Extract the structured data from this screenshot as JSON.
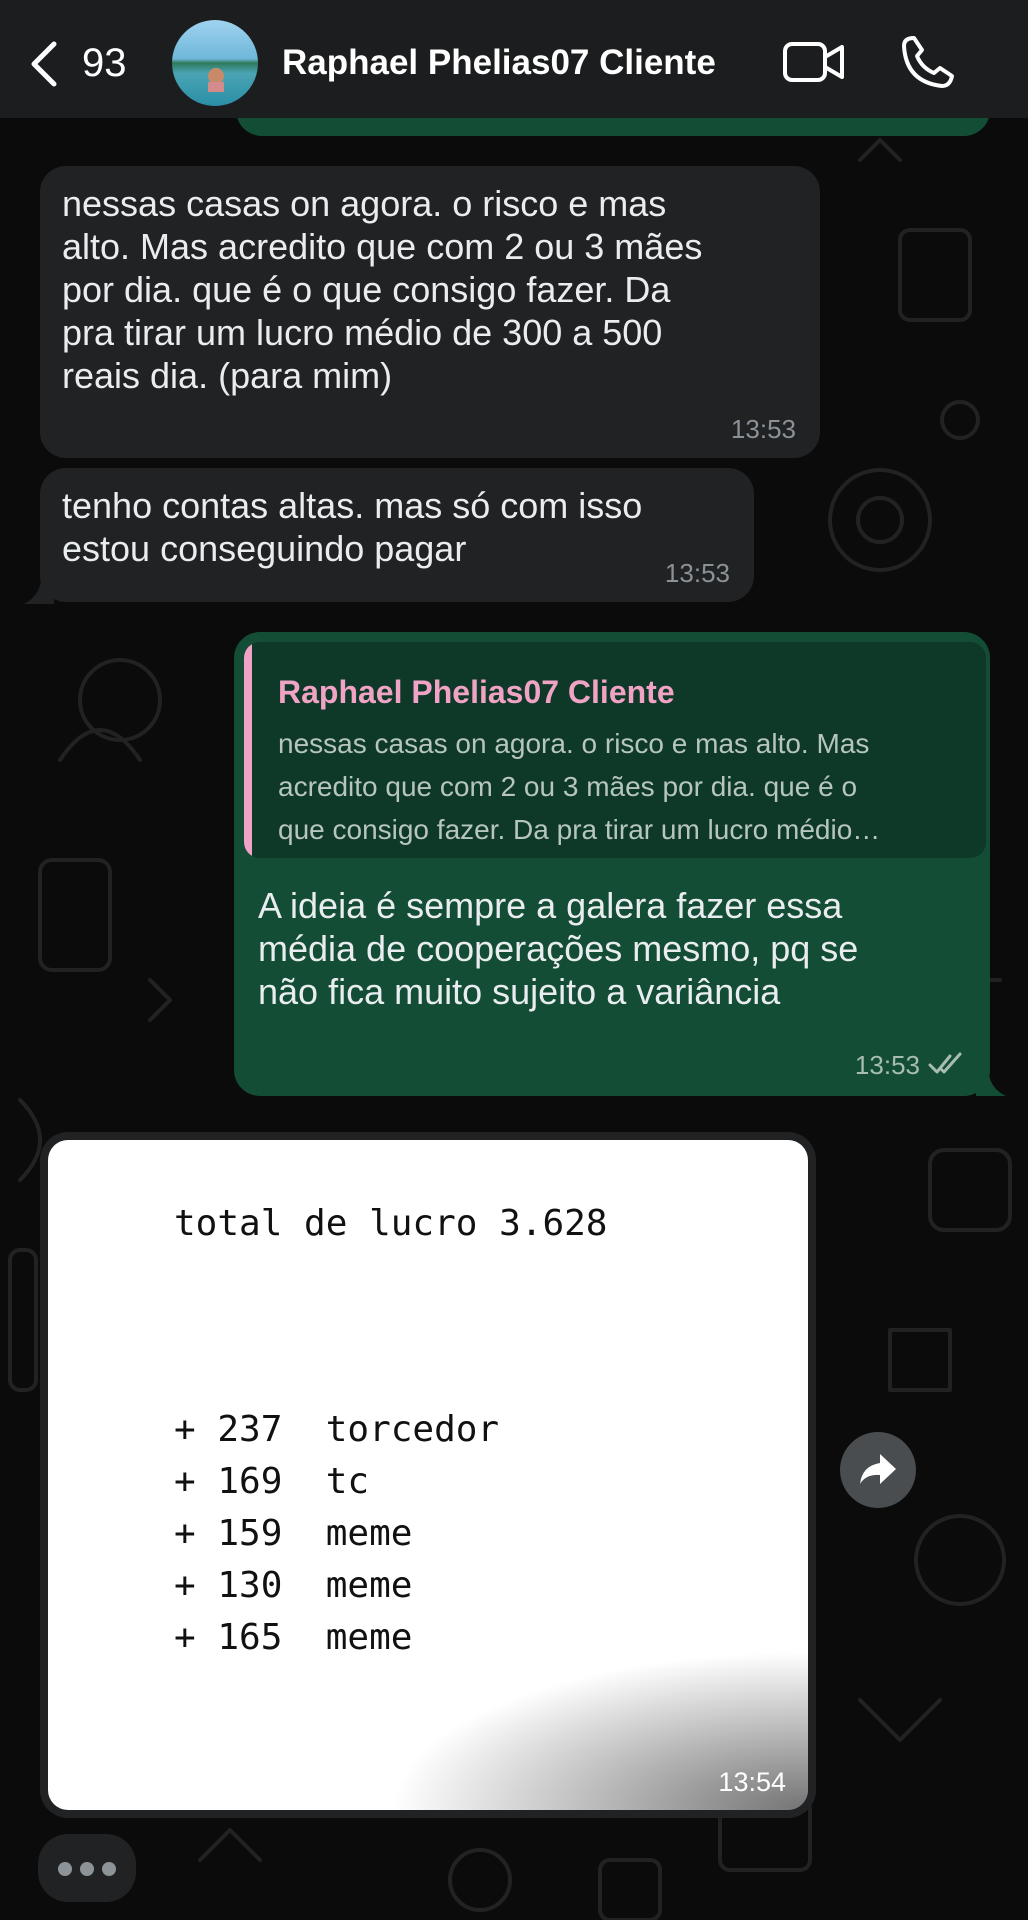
{
  "header": {
    "back_count": "93",
    "contact_name": "Raphael Phelias07 Cliente"
  },
  "messages": [
    {
      "direction": "in",
      "text": "nessas casas on agora. o risco e mas\nalto. Mas acredito que com 2 ou 3 mães\npor dia. que é o que consigo fazer. Da\npra tirar um lucro médio de 300 a 500\nreais dia. (para mim)",
      "time": "13:53"
    },
    {
      "direction": "in",
      "text": "tenho contas altas. mas só com isso\nestou conseguindo pagar",
      "time": "13:53"
    },
    {
      "direction": "out",
      "quote": {
        "author": "Raphael Phelias07 Cliente",
        "lines": [
          "nessas casas on agora. o risco e mas alto. Mas",
          "acredito que com 2 ou 3 mães por dia. que é o",
          "que consigo fazer. Da pra tirar um lucro médio…"
        ]
      },
      "text": "A ideia é sempre a galera fazer essa\nmédia de cooperações mesmo, pq se\nnão fica muito sujeito a variância",
      "time": "13:53",
      "status": "double-check-icon"
    },
    {
      "direction": "in",
      "type": "image",
      "image": {
        "total": "total de lucro 3.628",
        "rows": [
          "+ 237  torcedor",
          "+ 169  tc",
          "+ 159  meme",
          "+ 130  meme",
          "+ 165  meme"
        ]
      },
      "time": "13:54"
    }
  ],
  "colors": {
    "header_bg": "#1c1d1e",
    "incoming_bubble": "#202223",
    "outgoing_bubble": "#144d36",
    "quote_accent": "#f0a3c4",
    "background": "#0b0b0b"
  },
  "icons": [
    "chevron-left-icon",
    "video-call-icon",
    "phone-icon",
    "forward-icon",
    "typing-dots-icon"
  ]
}
